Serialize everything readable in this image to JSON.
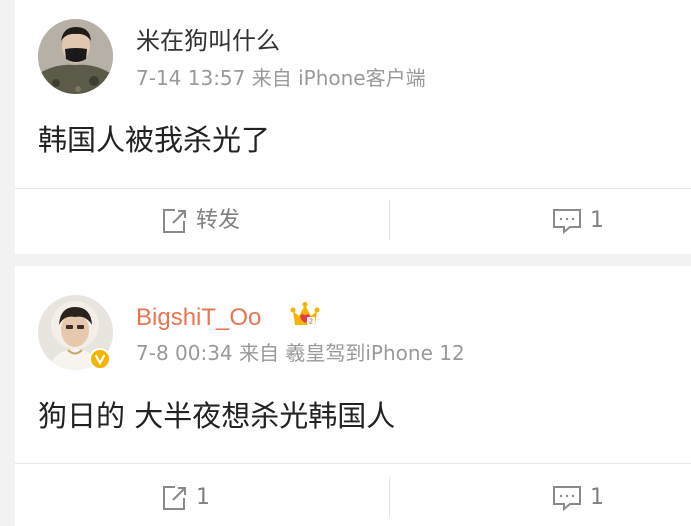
{
  "posts": [
    {
      "username": "米在狗叫什么",
      "meta": "7-14 13:57 来自 iPhone客户端",
      "text": "韩国人被我杀光了",
      "repost_label": "转发",
      "comment_count": "1"
    },
    {
      "username": "BigshiT_Oo",
      "meta": "7-8 00:34 来自 羲皇驾到iPhone 12",
      "text": "狗日的 大半夜想杀光韩国人",
      "repost_label": "1",
      "comment_count": "1"
    }
  ],
  "colors": {
    "page_bg": "#f2f2f2",
    "card_bg": "#ffffff",
    "username_vip": "#eb7350",
    "meta": "#999999",
    "verified": "#f5b400",
    "crown": "#f5b400",
    "crown_heart": "#e23a4e"
  },
  "icons": [
    "repost-icon",
    "comment-icon",
    "verified-badge-icon",
    "vip-crown-icon"
  ]
}
